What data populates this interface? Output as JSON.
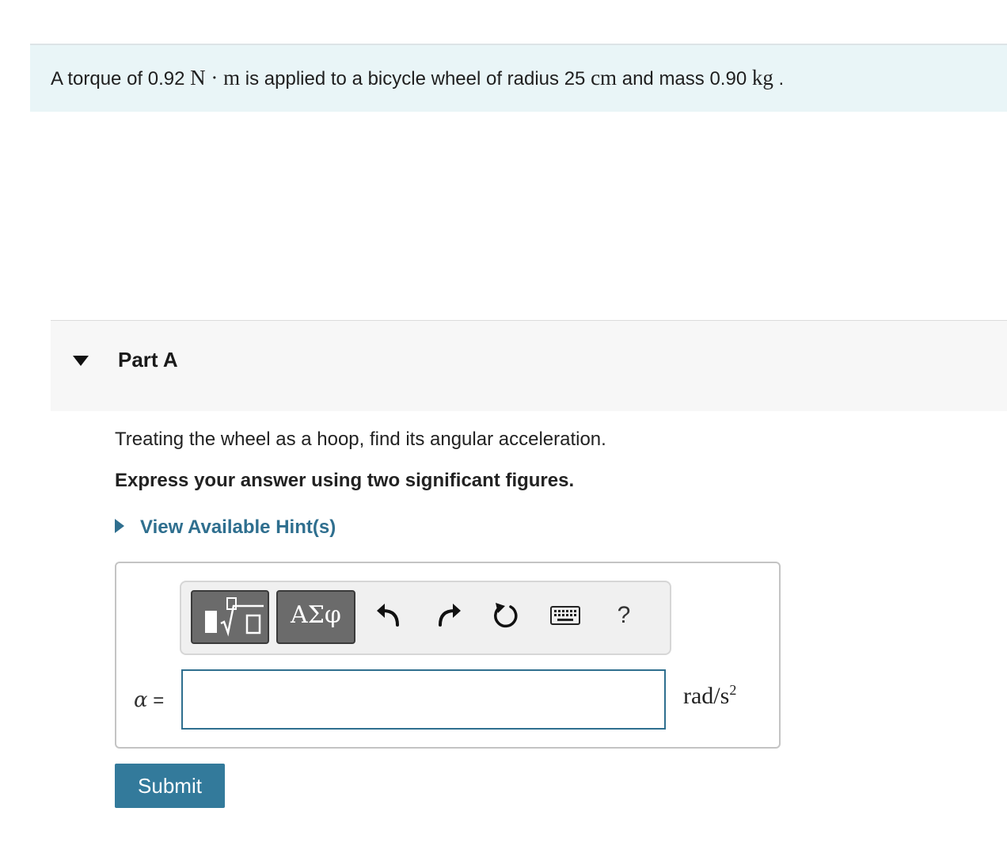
{
  "problem": {
    "text_1": "A torque of 0.92 ",
    "unit_torque": "N · m",
    "text_2": " is applied to a bicycle wheel of radius 25 ",
    "unit_radius": "cm",
    "text_3": " and mass 0.90 ",
    "unit_mass": "kg",
    "text_4": " ."
  },
  "part": {
    "title": "Part A",
    "question": "Treating the wheel as a hoop, find its angular acceleration.",
    "instruction": "Express your answer using two significant figures.",
    "hint_label": "View Available Hint(s)"
  },
  "toolbar": {
    "greek_label": "ΑΣφ",
    "help_label": "?",
    "icons": [
      "templates-icon",
      "greek-letters-icon",
      "undo-icon",
      "redo-icon",
      "reset-icon",
      "keyboard-icon",
      "help-icon"
    ]
  },
  "answer": {
    "variable": "α",
    "equals": " =",
    "input_value": "",
    "unit_base": "rad/s",
    "unit_exp": "2"
  },
  "submit_label": "Submit",
  "colors": {
    "banner_bg": "#e9f5f7",
    "accent": "#2f6f8f",
    "submit_bg": "#337a9b",
    "toolbar_button": "#6b6b6b"
  }
}
